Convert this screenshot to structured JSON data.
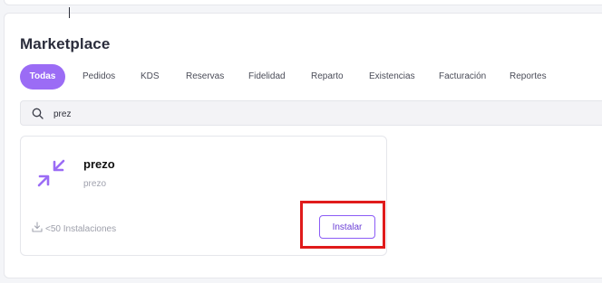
{
  "page": {
    "title": "Marketplace"
  },
  "tabs": [
    {
      "label": "Todas",
      "active": true
    },
    {
      "label": "Pedidos"
    },
    {
      "label": "KDS"
    },
    {
      "label": "Reservas"
    },
    {
      "label": "Fidelidad"
    },
    {
      "label": "Reparto"
    },
    {
      "label": "Existencias"
    },
    {
      "label": "Facturación"
    },
    {
      "label": "Reportes"
    }
  ],
  "search": {
    "value": "prez",
    "icon": "search-icon"
  },
  "app_card": {
    "name": "prezo",
    "description": "prezo",
    "installs": "<50 Instalaciones",
    "install_label": "Instalar",
    "logo_icon": "arrows-collapse-icon",
    "logo_color": "#9b6cf5"
  },
  "colors": {
    "accent": "#9b6cf5",
    "highlight": "#e01b1b"
  }
}
